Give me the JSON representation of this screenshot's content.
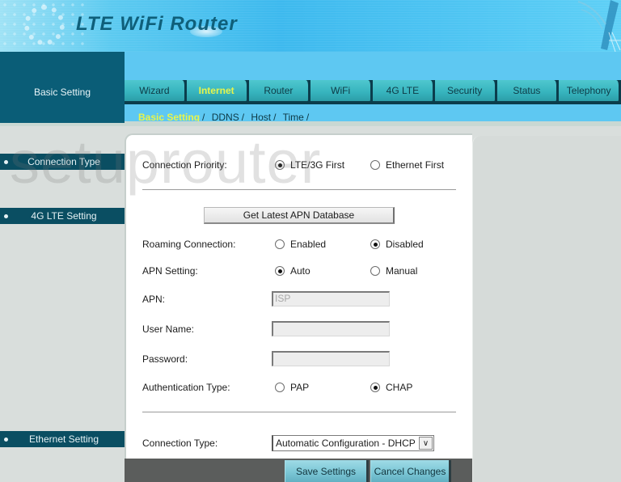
{
  "header": {
    "title": "LTE WiFi Router"
  },
  "section_label": "Basic Setting",
  "nav": {
    "tabs": [
      {
        "label": "Wizard",
        "active": false
      },
      {
        "label": "Internet",
        "active": true
      },
      {
        "label": "Router",
        "active": false
      },
      {
        "label": "WiFi",
        "active": false
      },
      {
        "label": "4G LTE",
        "active": false
      },
      {
        "label": "Security",
        "active": false
      },
      {
        "label": "Status",
        "active": false
      },
      {
        "label": "Telephony",
        "active": false
      }
    ],
    "subtabs": [
      {
        "label": "Basic Setting",
        "active": true
      },
      {
        "label": "DDNS",
        "active": false
      },
      {
        "label": "Host",
        "active": false
      },
      {
        "label": "Time",
        "active": false
      }
    ],
    "separator": "/"
  },
  "sidebar": {
    "items": [
      {
        "label": "Connection Type"
      },
      {
        "label": "4G LTE Setting"
      },
      {
        "label": "Ethernet Setting"
      }
    ]
  },
  "form": {
    "connection_priority": {
      "label": "Connection Priority:",
      "options": [
        "LTE/3G First",
        "Ethernet First"
      ],
      "selected": "LTE/3G First"
    },
    "apn_db_button": "Get Latest APN Database",
    "roaming": {
      "label": "Roaming Connection:",
      "options": [
        "Enabled",
        "Disabled"
      ],
      "selected": "Disabled"
    },
    "apn_setting": {
      "label": "APN Setting:",
      "options": [
        "Auto",
        "Manual"
      ],
      "selected": "Auto"
    },
    "apn": {
      "label": "APN:",
      "value": "ISP"
    },
    "username": {
      "label": "User Name:",
      "value": ""
    },
    "password": {
      "label": "Password:",
      "value": ""
    },
    "auth_type": {
      "label": "Authentication Type:",
      "options": [
        "PAP",
        "CHAP"
      ],
      "selected": "CHAP"
    },
    "connection_type": {
      "label": "Connection Type:",
      "value": "Automatic Configuration - DHCP"
    }
  },
  "actions": {
    "save": "Save Settings",
    "cancel": "Cancel Changes"
  },
  "watermark": "setuprouter",
  "colors": {
    "accent_active": "#e8f54a",
    "dark_teal": "#0a5d77",
    "nav_blue": "#5ec8f2",
    "tab_teal": "#36b3bd"
  }
}
